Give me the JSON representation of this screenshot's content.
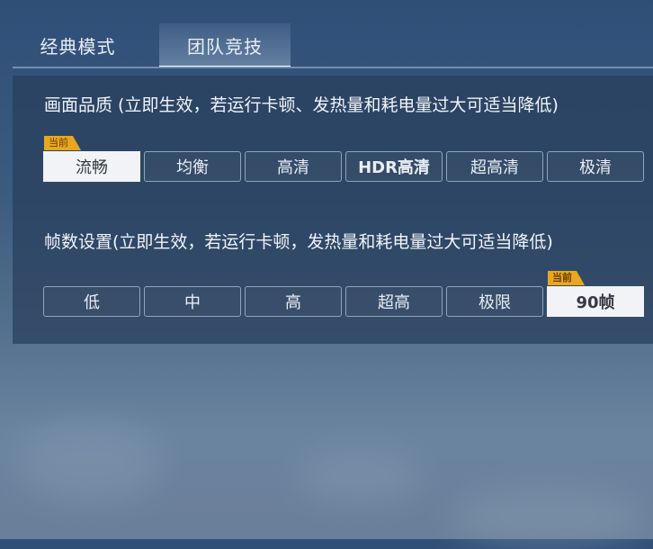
{
  "tabs": [
    {
      "label": "经典模式",
      "active": false
    },
    {
      "label": "团队竞技",
      "active": true
    }
  ],
  "quality": {
    "title": "画面品质 (立即生效，若运行卡顿、发热量和耗电量过大可适当降低)",
    "current_badge": "当前",
    "selected_index": 0,
    "options": [
      "流畅",
      "均衡",
      "高清",
      "HDR高清",
      "超高清",
      "极清"
    ]
  },
  "framerate": {
    "title": "帧数设置(立即生效，若运行卡顿，发热量和耗电量过大可适当降低)",
    "current_badge": "当前",
    "selected_index": 5,
    "options": [
      "低",
      "中",
      "高",
      "超高",
      "极限",
      "90帧"
    ]
  },
  "colors": {
    "badge": "#e8a81e",
    "selected_option_bg": "#f1f3f6",
    "tab_underline": "#ffffff"
  }
}
